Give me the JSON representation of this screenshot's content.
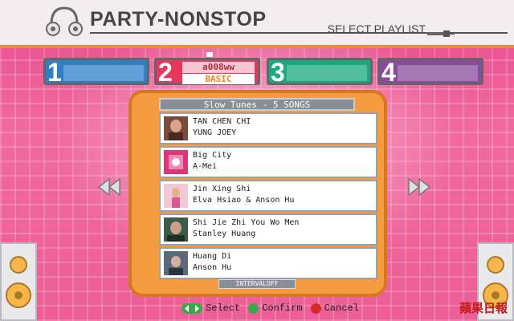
{
  "header": {
    "title": "PARTY-NONSTOP",
    "subtitle": "SELECT PLAYLIST"
  },
  "slots": [
    {
      "number": "1",
      "color": "#2e7fc8"
    },
    {
      "number": "2",
      "color": "#e7375a",
      "name": "a008ww",
      "mode": "BASIC"
    },
    {
      "number": "3",
      "color": "#1aa87e"
    },
    {
      "number": "4",
      "color": "#8a4c9a"
    }
  ],
  "playlist": {
    "title": "Slow Tunes - 5 SONGS",
    "songs": [
      {
        "title": "TAN CHEN CHI",
        "artist": "YUNG JOEY"
      },
      {
        "title": "Big City",
        "artist": "A-Mei"
      },
      {
        "title": "Jin Xing Shi",
        "artist": "Elva Hsiao & Anson Hu"
      },
      {
        "title": "Shi Jie Zhi You Wo Men",
        "artist": "Stanley Huang"
      },
      {
        "title": "Huang Di",
        "artist": "Anson Hu"
      }
    ],
    "interval": "INTERVALOFF"
  },
  "footer": {
    "select_label": "Select",
    "confirm_label": "Confirm",
    "cancel_label": "Cancel",
    "select_icon": "dpad-icon",
    "confirm_icon": "green-button-icon",
    "cancel_icon": "red-button-icon"
  },
  "watermark": "蘋果日報",
  "colors": {
    "background": "#ec5e98",
    "panel": "#f49c3f",
    "accent": "#f08a3a"
  }
}
